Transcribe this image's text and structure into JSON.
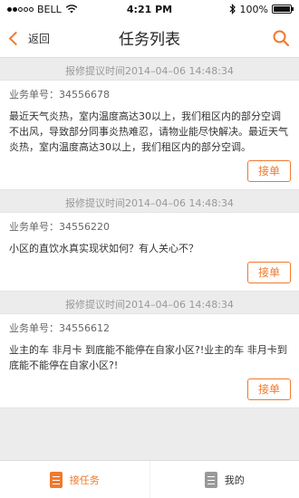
{
  "status_bar": {
    "carrier": "BELL",
    "time": "4:21 PM",
    "battery": "100%",
    "battery_level": 1.0,
    "signal_level": 1.0
  },
  "nav": {
    "back_label": "返回",
    "title": "任务列表"
  },
  "tasks": [
    {
      "time_label": "报修提议时间2014–04–06 14:48:34",
      "number_label": "业务单号：34556678",
      "content": "最近天气炎热，室内温度高达30以上，我们租区内的部分空调不出风，导致部分同事炎热难忍，请物业能尽快解决。最近天气炎热，室内温度高达30以上，我们租区内的部分空调。",
      "accept_label": "接单"
    },
    {
      "time_label": "报修提议时间2014–04–06 14:48:34",
      "number_label": "业务单号：34556220",
      "content": "小区的直饮水真实现状如何？有人关心不？",
      "accept_label": "接单"
    },
    {
      "time_label": "报修提议时间2014–04–06 14:48:34",
      "number_label": "业务单号：34556612",
      "content": "业主的车 非月卡 到底能不能停在自家小区?!业主的车 非月卡到底能不能停在自家小区?!",
      "accept_label": "接单"
    }
  ],
  "tabbar": {
    "tabs": [
      {
        "label": "接任务",
        "icon": "task-list-icon",
        "active": true
      },
      {
        "label": "我的",
        "icon": "my-tasks-icon",
        "active": false
      }
    ]
  },
  "colors": {
    "accent": "#f07a2e",
    "background": "#ececec"
  }
}
